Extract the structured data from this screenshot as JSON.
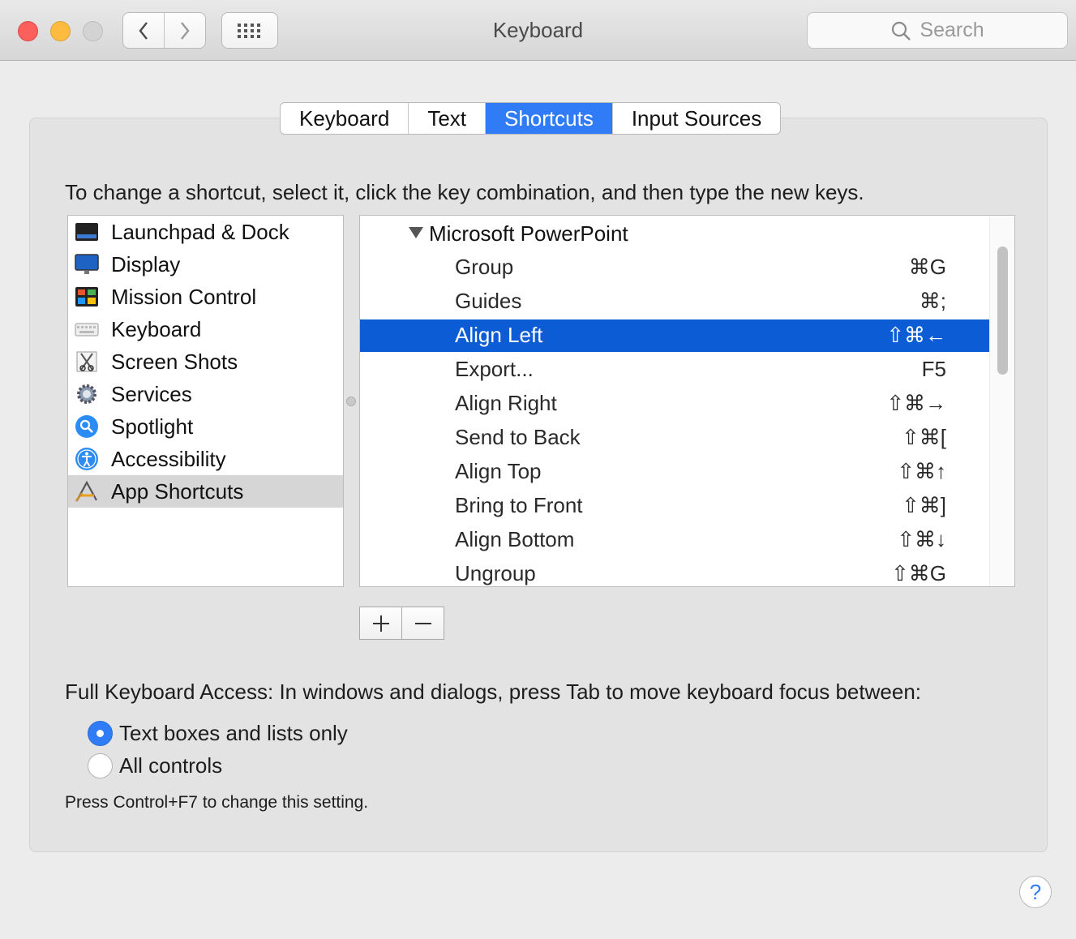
{
  "window": {
    "title": "Keyboard"
  },
  "search": {
    "placeholder": "Search"
  },
  "tabs": [
    {
      "label": "Keyboard",
      "active": false
    },
    {
      "label": "Text",
      "active": false
    },
    {
      "label": "Shortcuts",
      "active": true
    },
    {
      "label": "Input Sources",
      "active": false
    }
  ],
  "instructions": "To change a shortcut, select it, click the key combination, and then type the new keys.",
  "categories": [
    {
      "label": "Launchpad & Dock",
      "icon": "launchpad-dock-icon"
    },
    {
      "label": "Display",
      "icon": "display-icon"
    },
    {
      "label": "Mission Control",
      "icon": "mission-control-icon"
    },
    {
      "label": "Keyboard",
      "icon": "keyboard-icon"
    },
    {
      "label": "Screen Shots",
      "icon": "screenshot-icon"
    },
    {
      "label": "Services",
      "icon": "gear-icon"
    },
    {
      "label": "Spotlight",
      "icon": "spotlight-icon"
    },
    {
      "label": "Accessibility",
      "icon": "accessibility-icon"
    },
    {
      "label": "App Shortcuts",
      "icon": "app-shortcuts-icon",
      "selected": true
    }
  ],
  "shortcuts": {
    "group": "Microsoft PowerPoint",
    "items": [
      {
        "label": "Group",
        "keys": "⌘G"
      },
      {
        "label": "Guides",
        "keys": "⌘;"
      },
      {
        "label": "Align Left",
        "keys": "⇧⌘←",
        "selected": true
      },
      {
        "label": "Export...",
        "keys": "F5"
      },
      {
        "label": "Align Right",
        "keys": "⇧⌘→"
      },
      {
        "label": "Send to Back",
        "keys": "⇧⌘["
      },
      {
        "label": "Align Top",
        "keys": "⇧⌘↑"
      },
      {
        "label": "Bring to Front",
        "keys": "⇧⌘]"
      },
      {
        "label": "Align Bottom",
        "keys": "⇧⌘↓"
      },
      {
        "label": "Ungroup",
        "keys": "⇧⌘G"
      }
    ]
  },
  "full_keyboard_access": {
    "label": "Full Keyboard Access: In windows and dialogs, press Tab to move keyboard focus between:",
    "options": [
      {
        "label": "Text boxes and lists only",
        "selected": true
      },
      {
        "label": "All controls",
        "selected": false
      }
    ],
    "hint": "Press Control+F7 to change this setting."
  },
  "help": {
    "label": "?"
  },
  "colors": {
    "accent": "#2f7cf6",
    "selection": "#0b5cd5"
  }
}
